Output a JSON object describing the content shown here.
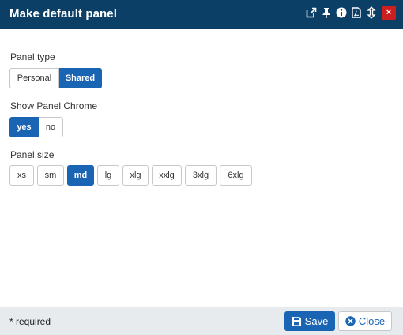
{
  "dialog": {
    "title": "Make default panel",
    "close_glyph": "×",
    "header_icons": [
      "external-link-icon",
      "pin-icon",
      "info-icon",
      "pdf-icon",
      "resize-vertical-icon"
    ]
  },
  "panel_type": {
    "label": "Panel type",
    "options": [
      "Personal",
      "Shared"
    ],
    "selected": "Shared"
  },
  "panel_chrome": {
    "label": "Show Panel Chrome",
    "options": [
      "yes",
      "no"
    ],
    "selected": "yes"
  },
  "panel_size": {
    "label": "Panel size",
    "options": [
      "xs",
      "sm",
      "md",
      "lg",
      "xlg",
      "xxlg",
      "3xlg",
      "6xlg"
    ],
    "selected": "md"
  },
  "footer": {
    "required_note": "* required",
    "save_label": "Save",
    "close_label": "Close"
  },
  "colors": {
    "header_bg": "#0c3f66",
    "accent": "#1a64b4",
    "close_red": "#cc1f1f",
    "footer_bg": "#e8ebee"
  }
}
